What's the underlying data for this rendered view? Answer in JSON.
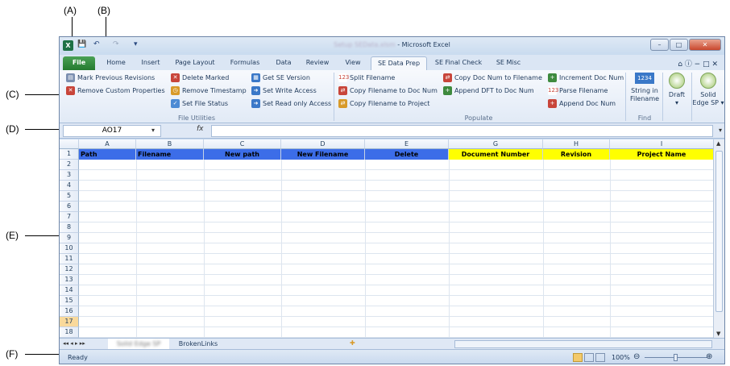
{
  "callouts": {
    "a": "(A)",
    "b": "(B)",
    "c": "(C)",
    "d": "(D)",
    "e": "(E)",
    "f": "(F)"
  },
  "window": {
    "title_blurred": "Setup SEData.xlsm",
    "title_suffix": " - Microsoft Excel",
    "app_icon": "X",
    "qat": {
      "save": "💾",
      "undo": "↶",
      "redo": "↷",
      "customize": "▾"
    },
    "buttons": {
      "minimize": "–",
      "maximize": "□",
      "close": "✕"
    }
  },
  "tabs": [
    {
      "label": "File"
    },
    {
      "label": "Home"
    },
    {
      "label": "Insert"
    },
    {
      "label": "Page Layout"
    },
    {
      "label": "Formulas"
    },
    {
      "label": "Data"
    },
    {
      "label": "Review"
    },
    {
      "label": "View"
    },
    {
      "label": "SE Data Prep"
    },
    {
      "label": "SE Final Check"
    },
    {
      "label": "SE Misc"
    }
  ],
  "tab_right": "⌂ ⓘ − □ ✕",
  "ribbon": {
    "file_utilities": {
      "label": "File Utilities",
      "mark_previous": "Mark Previous Revisions",
      "remove_custom": "Remove Custom Properties",
      "delete_marked": "Delete Marked",
      "remove_timestamp": "Remove Timestamp",
      "set_file_status": "Set File Status",
      "get_se_version": "Get SE Version",
      "set_write_access": "Set Write Access",
      "set_read_only": "Set Read only Access"
    },
    "populate": {
      "label": "Populate",
      "split_filename": "Split Filename",
      "copy_fn_docnum": "Copy Filename to Doc Num",
      "copy_fn_project": "Copy Filename to Project",
      "copy_docnum_fn": "Copy Doc Num to Filename",
      "append_dft": "Append DFT to Doc Num",
      "increment_docnum": "Increment Doc Num",
      "parse_filename": "Parse Filename",
      "append_docnum": "Append Doc Num"
    },
    "find": {
      "label": "Find",
      "string_in_filename_1": "String in",
      "string_in_filename_2": "Filename"
    },
    "draft": {
      "label": "Draft",
      "arrow": "▾"
    },
    "solid_edge_sp": {
      "label_1": "Solid",
      "label_2": "Edge SP ▾"
    }
  },
  "formula_bar": {
    "name_box": "AO17",
    "fx": "fx",
    "value": ""
  },
  "columns": [
    "A",
    "B",
    "C",
    "D",
    "E",
    "G",
    "H",
    "I"
  ],
  "header_row": {
    "row_number": "1",
    "cells": [
      "Path",
      "Filename",
      "New path",
      "New Filename",
      "Delete",
      "Document Number",
      "Revision",
      "Project Name"
    ]
  },
  "rows": [
    "2",
    "3",
    "4",
    "5",
    "6",
    "7",
    "8",
    "9",
    "10",
    "11",
    "12",
    "13",
    "14",
    "15",
    "16",
    "17",
    "18"
  ],
  "selected_row": "17",
  "sheets": {
    "blurred": "Solid Edge SP",
    "other": "BrokenLinks"
  },
  "status": {
    "ready": "Ready",
    "zoom": "100%"
  },
  "colors": {
    "blue_header": "#3c6de8",
    "yellow_header": "#ffff00"
  }
}
